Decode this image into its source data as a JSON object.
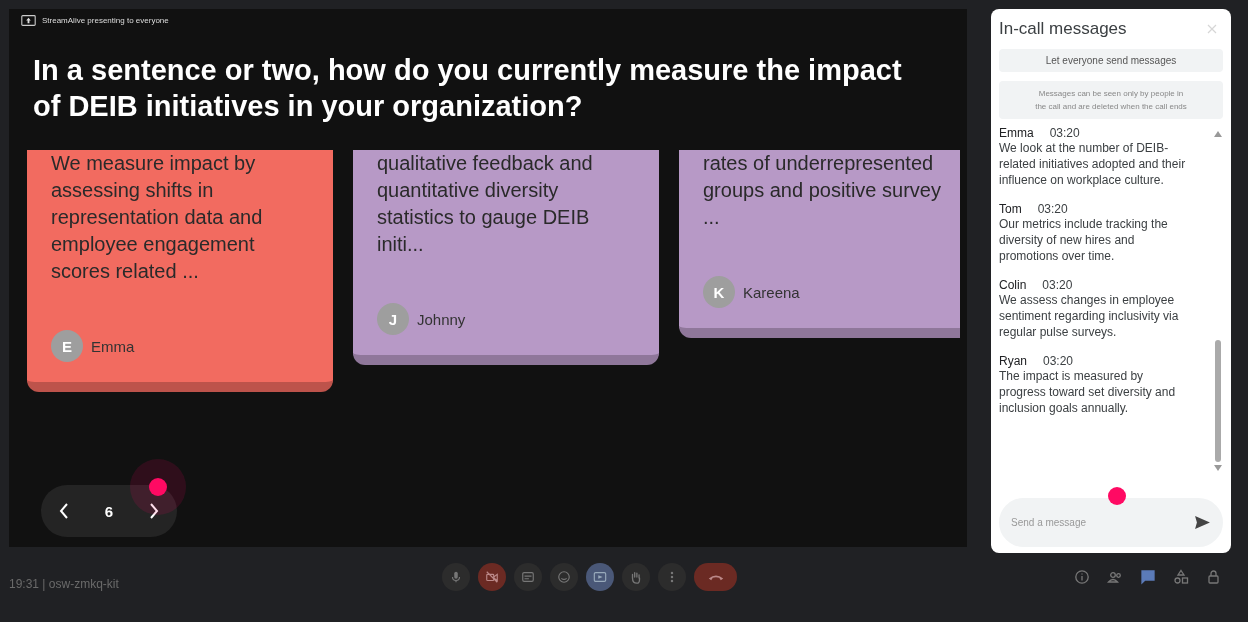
{
  "presenter_banner": "StreamAlive presenting to everyone",
  "question": "In a sentence or two, how do you currently measure the impact of DEIB initiatives in your organization?",
  "cards": [
    {
      "text": "We measure impact by assessing shifts in representation data and employee engagement scores related ...",
      "author": "Emma",
      "initial": "E",
      "color": "#f26b60"
    },
    {
      "text": "qualitative feedback and quantitative diversity statistics to gauge DEIB initi...",
      "author": "Johnny",
      "initial": "J",
      "color": "#b799c6"
    },
    {
      "text": "rates of underrepresented groups and positive survey ...",
      "author": "Kareena",
      "initial": "K",
      "color": "#b799c6"
    }
  ],
  "slide_nav": {
    "page": "6"
  },
  "chat": {
    "title": "In-call messages",
    "toggle_label": "Let everyone send messages",
    "notice": "Messages can be seen only by people in the call and are deleted when the call ends",
    "messages": [
      {
        "sender": "Emma",
        "time": "03:20",
        "text": "We look at the number of DEIB-related initiatives adopted and their influence on workplace culture."
      },
      {
        "sender": "Tom",
        "time": "03:20",
        "text": "Our metrics include tracking the diversity of new hires and promotions over time."
      },
      {
        "sender": "Colin",
        "time": "03:20",
        "text": "We assess changes in employee sentiment regarding inclusivity via regular pulse surveys."
      },
      {
        "sender": "Ryan",
        "time": "03:20",
        "text": "The impact is measured by progress toward set diversity and inclusion goals annually."
      }
    ],
    "input": {
      "placeholder": "Send a message"
    }
  },
  "bottom_bar": {
    "meeting_info": "19:31 | osw-zmkq-kit",
    "controls": [
      {
        "kind": "mic"
      },
      {
        "kind": "camera_off"
      },
      {
        "kind": "captions"
      },
      {
        "kind": "emoji"
      },
      {
        "kind": "present"
      },
      {
        "kind": "hand"
      },
      {
        "kind": "more"
      },
      {
        "kind": "hangup"
      }
    ],
    "side_icons": [
      {
        "kind": "info",
        "selected": false
      },
      {
        "kind": "people",
        "selected": false
      },
      {
        "kind": "chat",
        "selected": true
      },
      {
        "kind": "activities",
        "selected": false
      },
      {
        "kind": "lock",
        "selected": false
      }
    ]
  }
}
